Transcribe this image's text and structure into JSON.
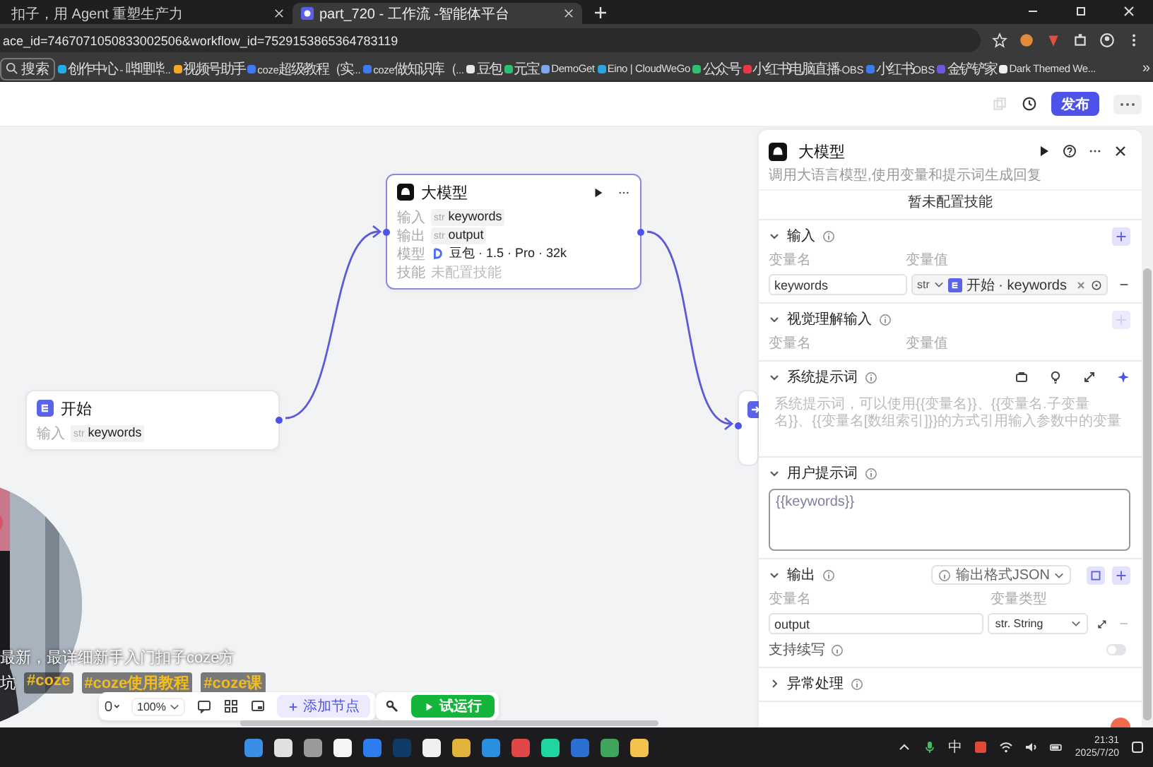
{
  "browser": {
    "tabs": [
      {
        "title": "扣子，用 Agent 重塑生产力",
        "selected": false
      },
      {
        "title": "part_720 - 工作流 -智能体平台",
        "selected": true
      }
    ],
    "url": "ace_id=7467071050833002506&workflow_id=7529153865364783119",
    "search_overlay": "搜索",
    "bookmarks": [
      {
        "title": "创作中心 - 哔哩哔...",
        "color": "#23ade5"
      },
      {
        "title": "视频号助手",
        "color": "#f5a623"
      },
      {
        "title": "coze超级教程（实...",
        "color": "#3b7cf6"
      },
      {
        "title": "coze做知识库（...",
        "color": "#3b7cf6"
      },
      {
        "title": "豆包",
        "color": "#e8e8e8"
      },
      {
        "title": "元宝",
        "color": "#2fbf71"
      },
      {
        "title": "DemoGet",
        "color": "#7ea6f0"
      },
      {
        "title": "Eino | CloudWeGo",
        "color": "#2aa4e0"
      },
      {
        "title": "公众号",
        "color": "#2fbf71"
      },
      {
        "title": "小红书电脑直播-OBS",
        "color": "#e83a45"
      },
      {
        "title": "小红书OBS",
        "color": "#3b7cf6"
      },
      {
        "title": "金铲铲家",
        "color": "#6a5ae0"
      },
      {
        "title": "Dark Themed We...",
        "color": "#f0f0f0"
      }
    ],
    "more_bookmarks": "»"
  },
  "header": {
    "publish_button": "发布"
  },
  "canvas": {
    "nodes": [
      {
        "kind": "llm",
        "title": "大模型",
        "rows": [
          {
            "kind": "variable",
            "label": "输入",
            "type": "str",
            "value": "keywords"
          },
          {
            "kind": "variable",
            "label": "输出",
            "type": "str",
            "value": "output"
          },
          {
            "kind": "model",
            "label": "模型",
            "value": "豆包 · 1.5 · Pro · 32k"
          },
          {
            "kind": "empty",
            "label": "技能",
            "value": "未配置技能"
          }
        ]
      },
      {
        "kind": "start",
        "title": "开始",
        "rows": [
          {
            "kind": "variable",
            "label": "输入",
            "type": "str",
            "value": "keywords"
          }
        ]
      }
    ],
    "caption": {
      "line_1": "最新，最详细新手入门扣子coze方",
      "line_2": [
        {
          "kind": "plain",
          "text": "坑"
        },
        {
          "kind": "tag",
          "text": "#coze"
        },
        {
          "kind": "tag",
          "text": "#coze使用教程"
        },
        {
          "kind": "tag",
          "text": "#coze课"
        }
      ]
    },
    "toolbar": {
      "zoom": "100%",
      "add_node_button": "添加节点",
      "test_run_button": "试运行"
    }
  },
  "panel": {
    "title": "大模型",
    "description": "调用大语言模型,使用变量和提示词生成回复",
    "skills_empty": "暂未配置技能",
    "sections": [
      {
        "kind": "params",
        "title": "输入",
        "expanded": true,
        "add_disabled": false,
        "columns": [
          "变量名",
          "变量值"
        ],
        "rows": [
          {
            "name": "keywords",
            "type": "str",
            "ref": "开始 · keywords"
          }
        ]
      },
      {
        "kind": "params",
        "title": "视觉理解输入",
        "expanded": true,
        "add_disabled": true,
        "columns": [
          "变量名",
          "变量值"
        ]
      },
      {
        "kind": "prompt",
        "title": "系统提示词",
        "expanded": true,
        "tools": true,
        "focused": false,
        "placeholder": "系统提示词，可以使用{{变量名}}、{{变量名.子变量名}}、{{变量名[数组索引]}}的方式引用输入参数中的变量"
      },
      {
        "kind": "prompt",
        "title": "用户提示词",
        "expanded": true,
        "tools": false,
        "focused": true,
        "value": "{{keywords}}"
      },
      {
        "kind": "output",
        "title": "输出",
        "expanded": true,
        "format": "输出格式JSON",
        "columns": [
          "变量名",
          "变量类型"
        ],
        "rows": [
          {
            "name": "output",
            "type": "str. String"
          }
        ],
        "stream_label": "支持续写",
        "stream_on": false
      },
      {
        "kind": "plain",
        "title": "异常处理",
        "expanded": false
      }
    ]
  },
  "taskbar": {
    "apps": [
      {
        "color": "#3a8ee6"
      },
      {
        "color": "#e0e0e0"
      },
      {
        "color": "#9a9a9a"
      },
      {
        "color": "#f5f5f5"
      },
      {
        "color": "#2d7cf0"
      },
      {
        "color": "#0f3b66"
      },
      {
        "color": "#f0f0f0"
      },
      {
        "color": "#e2b33a"
      },
      {
        "color": "#2b8fe0"
      },
      {
        "color": "#e04848"
      },
      {
        "color": "#1fd6a0"
      },
      {
        "color": "#2b6fd0"
      },
      {
        "color": "#3fa55c"
      },
      {
        "color": "#f2c14e"
      }
    ],
    "ime": "中",
    "time": "21:31",
    "date": "2025/7/20"
  }
}
